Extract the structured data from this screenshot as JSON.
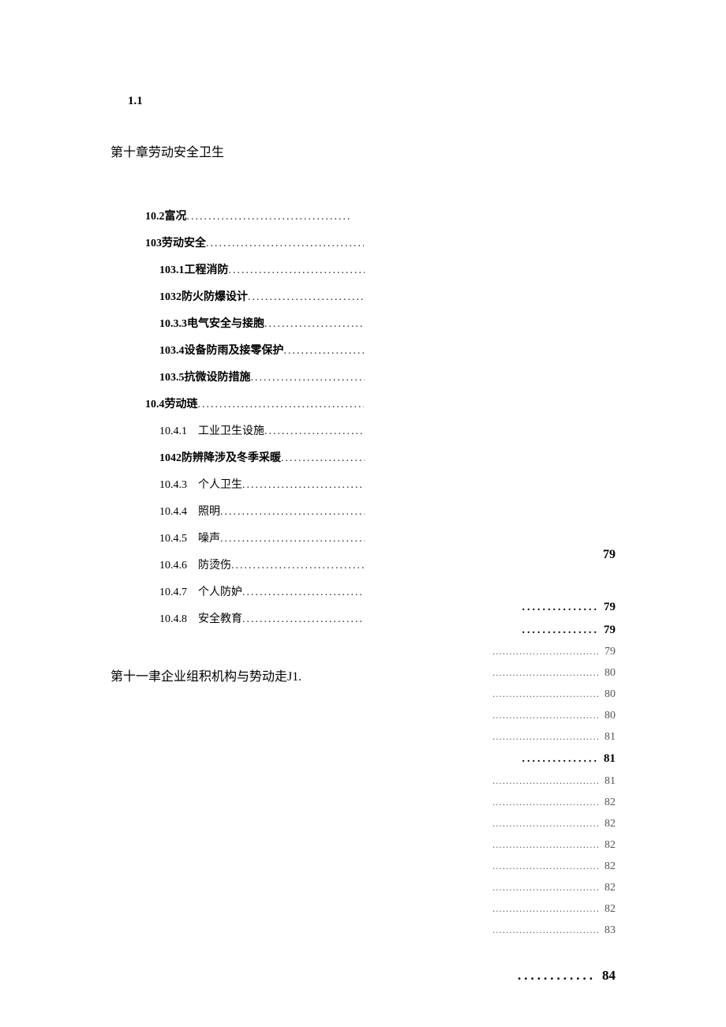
{
  "header_num": "1.1",
  "chapter10_title": "第十章劳动安全卫生",
  "toc_left": [
    {
      "label": "10.2富况",
      "bold": true,
      "level": "lvl0"
    },
    {
      "label": "103劳动安全 ",
      "bold": true,
      "level": "lvl00"
    },
    {
      "label": "103.1工程消防",
      "bold": true,
      "level": "lvl1"
    },
    {
      "label": "1032防火防爆设计 ",
      "bold": true,
      "level": "lvl1"
    },
    {
      "label": "10.3.3电气安全与接胞",
      "bold": true,
      "level": "lvl1"
    },
    {
      "label": "103.4设备防雨及接零保护",
      "bold": true,
      "level": "lvl1"
    },
    {
      "label": "103.5抗微设防措施 ",
      "bold": true,
      "level": "lvl1"
    },
    {
      "label": "10.4劳动琏",
      "bold": true,
      "level": "lvl00"
    },
    {
      "label": "10.4.1 工业卫生设施",
      "bold": false,
      "level": "lvl1"
    },
    {
      "label": "1042防辨降涉及冬季采暖",
      "bold": true,
      "level": "lvl1"
    },
    {
      "label": "10.4.3 个人卫生",
      "bold": false,
      "level": "lvl1"
    },
    {
      "label": "10.4.4 照明",
      "bold": false,
      "level": "lvl1"
    },
    {
      "label": "10.4.5 噪声 ",
      "bold": false,
      "level": "lvl1"
    },
    {
      "label": "10.4.6 防烫伤",
      "bold": false,
      "level": "lvl1"
    },
    {
      "label": "10.4.7 个人防妒",
      "bold": false,
      "level": "lvl1"
    },
    {
      "label": "10.4.8 安全教育",
      "bold": false,
      "level": "lvl1"
    }
  ],
  "chapter11_title": "第十一聿企业组积机构与势动走J1.",
  "top_79": "79",
  "right_pages": [
    {
      "page": "79",
      "bold": true
    },
    {
      "page": "79",
      "bold": true
    },
    {
      "page": "79",
      "bold": false
    },
    {
      "page": "80",
      "bold": false
    },
    {
      "page": "80",
      "bold": false
    },
    {
      "page": "80",
      "bold": false
    },
    {
      "page": "81",
      "bold": false
    },
    {
      "page": "81",
      "bold": true
    },
    {
      "page": "81",
      "bold": false
    },
    {
      "page": "82",
      "bold": false
    },
    {
      "page": "82",
      "bold": false
    },
    {
      "page": "82",
      "bold": false
    },
    {
      "page": "82",
      "bold": false
    },
    {
      "page": "82",
      "bold": false
    },
    {
      "page": "82",
      "bold": false
    },
    {
      "page": "83",
      "bold": false
    }
  ],
  "bottom_84": "84"
}
